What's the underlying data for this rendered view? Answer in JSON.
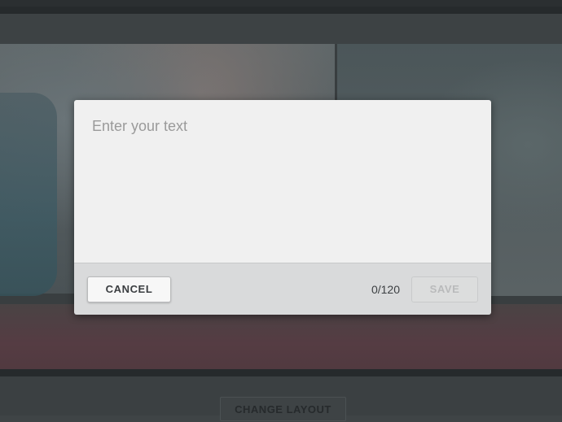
{
  "background": {
    "change_layout_label": "CHANGE LAYOUT"
  },
  "modal": {
    "input": {
      "value": "",
      "placeholder": "Enter your text"
    },
    "counter": "0/120",
    "cancel_label": "CANCEL",
    "save_label": "SAVE",
    "save_disabled": true
  }
}
